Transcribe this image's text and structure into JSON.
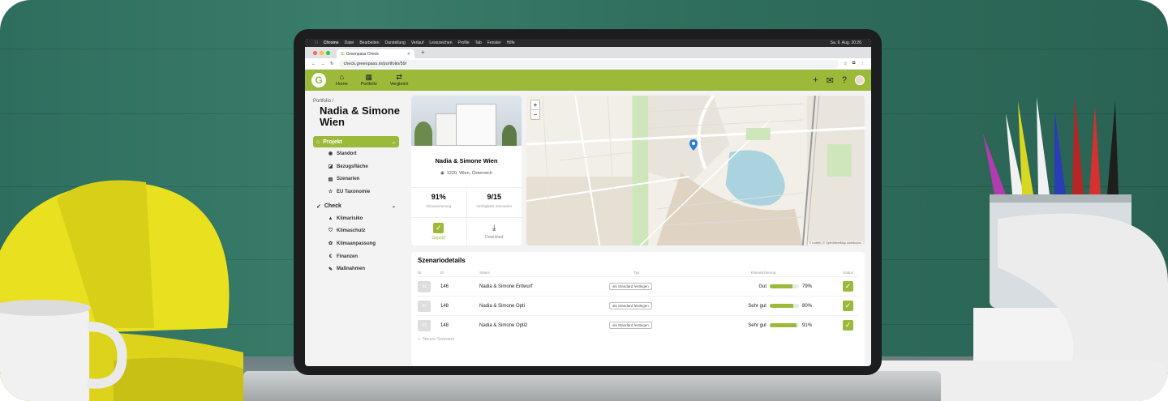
{
  "menubar": {
    "app": "Chrome",
    "items": [
      "Datei",
      "Bearbeiten",
      "Darstellung",
      "Verlauf",
      "Lesezeichen",
      "Profile",
      "Tab",
      "Fenster",
      "Hilfe"
    ],
    "clock": "Sa. 9. Aug. 20:26"
  },
  "browser": {
    "tab_title": "Greenpass Check",
    "url": "check.greenpass.io/portfolio/59/"
  },
  "header": {
    "logo": "G",
    "nav": [
      {
        "label": "Home",
        "icon": "home-icon"
      },
      {
        "label": "Portfolio",
        "icon": "portfolio-icon"
      },
      {
        "label": "Vergleich",
        "icon": "compare-icon"
      }
    ],
    "icons": [
      "plus-icon",
      "mail-icon",
      "help-icon",
      "avatar"
    ]
  },
  "sidebar": {
    "breadcrumb": "Portfolio /",
    "title": "Nadia & Simone Wien",
    "project_label": "Projekt",
    "project_items": [
      "Standort",
      "Bezugsfläche",
      "Szenarien",
      "EU Taxonomie"
    ],
    "check_label": "Check",
    "check_items": [
      "Klimarisiko",
      "Klimaschutz",
      "Klimaanpassung",
      "Finanzen",
      "Maßnahmen"
    ]
  },
  "project": {
    "name": "Nadia & Simone Wien",
    "address": "1220, Wien, Österreich",
    "stat1_value": "91%",
    "stat1_label": "Klimasicherung",
    "stat2_value": "9/15",
    "stat2_label": "Verfügbare Szenarien",
    "action1": "Geprüft",
    "action2": "Download"
  },
  "map": {
    "zoom_in": "+",
    "zoom_out": "−",
    "attribution": "© Leaflet | © OpenStreetMap contributors"
  },
  "scenarios": {
    "title": "Szenariodetails",
    "columns": [
      "Nr.",
      "ID",
      "Status",
      "Typ",
      "Klimasicherung",
      "Status"
    ],
    "rows": [
      {
        "nr": "01",
        "id": "146",
        "name": "Nadia & Simone Entwurf",
        "type": "als Standard festlegen",
        "rating": "Gut",
        "percent": "79%",
        "value": 79
      },
      {
        "nr": "02",
        "id": "148",
        "name": "Nadia & Simone Opti",
        "type": "als Standard festlegen",
        "rating": "Sehr gut",
        "percent": "80%",
        "value": 80
      },
      {
        "nr": "03",
        "id": "148",
        "name": "Nadia & Simone Opti2",
        "type": "als Standard festlegen",
        "rating": "Sehr gut",
        "percent": "91%",
        "value": 91
      }
    ],
    "new_label": "Neues Szenario"
  },
  "colors": {
    "accent": "#9cb93a",
    "wall": "#2f6d5c"
  }
}
